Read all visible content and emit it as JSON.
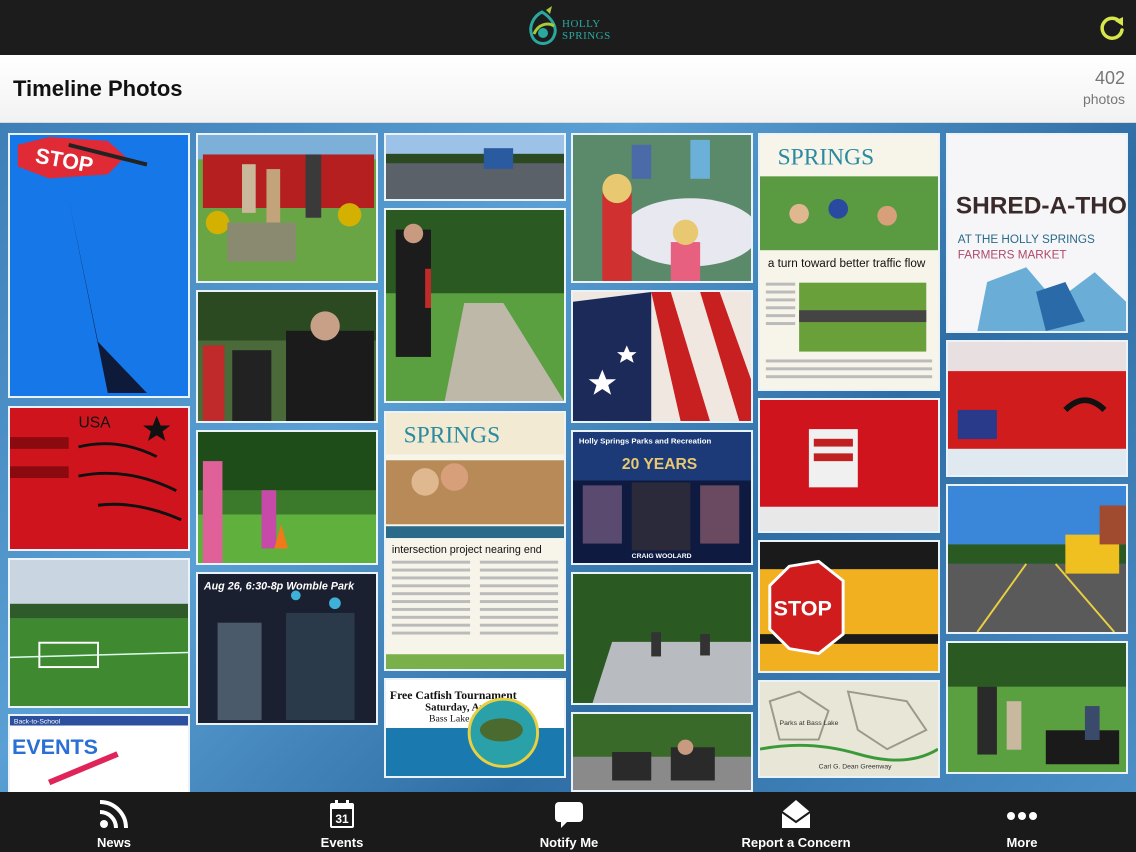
{
  "header": {
    "logo_line1": "HOLLY",
    "logo_line2": "SPRINGS",
    "refresh_icon": "refresh-icon"
  },
  "titlebar": {
    "title": "Timeline Photos",
    "count": "402",
    "count_label": "photos"
  },
  "photos": {
    "stop_sign": "STOP",
    "flag_text": "USA",
    "archery_text": "Aug 26, 6:30-8p Womble Park",
    "events_small": "Back-to-School",
    "events_big": "EVENTS",
    "springs1_title": "SPRINGS",
    "springs1_headline": "a turn toward better traffic flow",
    "springs2_title": "SPRINGS",
    "springs2_headline": "intersection project nearing end",
    "anniv_title": "Holly Springs Parks and Recreation",
    "anniv_years": "20 YEARS",
    "anniv_name": "CRAIG WOOLARD",
    "catfish_title": "Free Catfish Tournament",
    "catfish_date": "Saturday, Aug",
    "catfish_place": "Bass Lake Park",
    "shred_title": "SHRED-A-THON",
    "shred_sub": "AT THE HOLLY SPRINGS",
    "shred_sub2": "FARMERS MARKET",
    "school_stop": "STOP",
    "map_label1": "Parks at Bass Lake",
    "map_label2": "Carl G. Dean Greenway"
  },
  "tabs": [
    {
      "label": "News",
      "icon": "rss-icon"
    },
    {
      "label": "Events",
      "icon": "calendar-icon",
      "day": "31"
    },
    {
      "label": "Notify Me",
      "icon": "chat-bubble-icon"
    },
    {
      "label": "Report a Concern",
      "icon": "envelope-icon"
    },
    {
      "label": "More",
      "icon": "more-dots-icon"
    }
  ],
  "colors": {
    "accent_refresh": "#d7e64a",
    "background_blue": "#3e7fb8",
    "tabbar": "#1a1a1a"
  }
}
